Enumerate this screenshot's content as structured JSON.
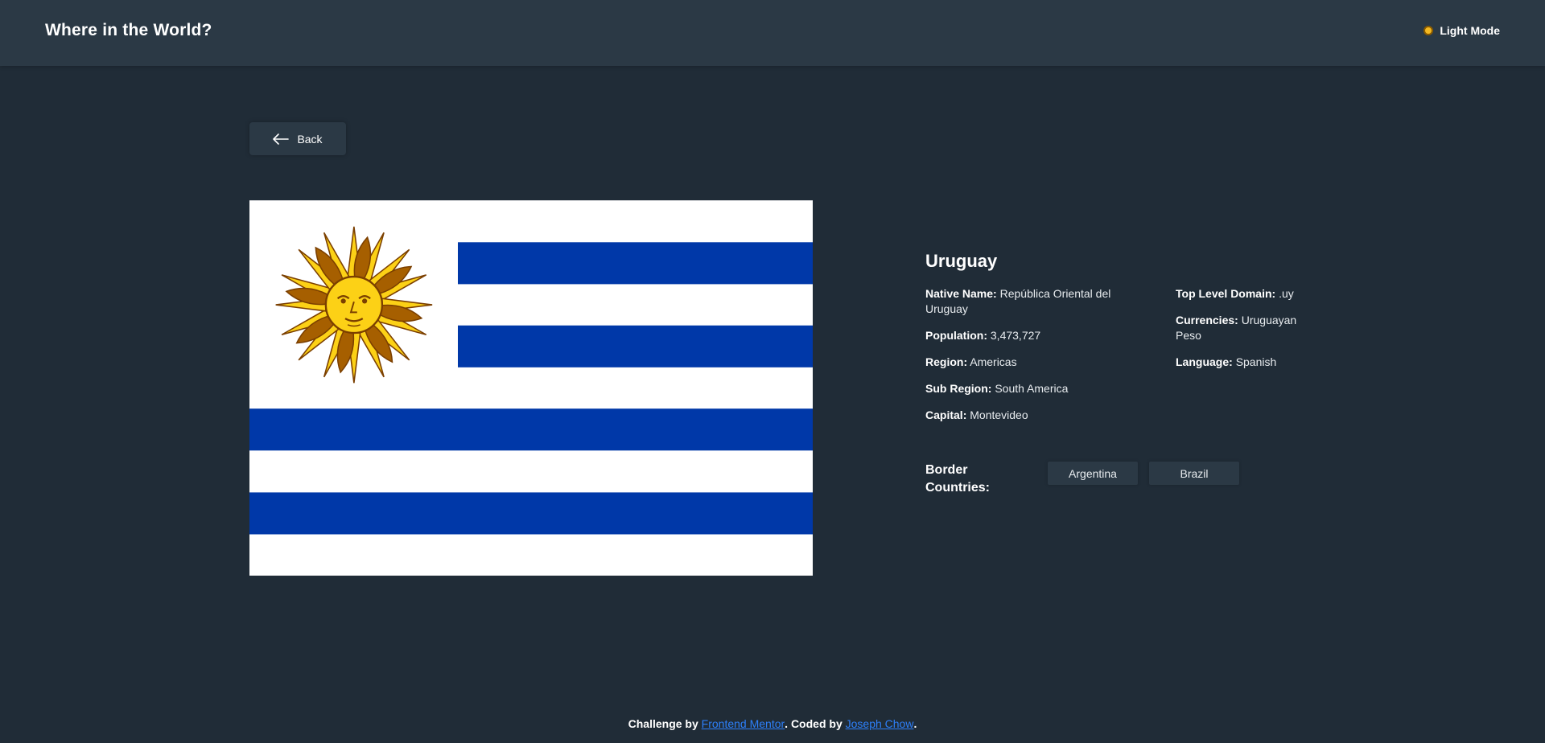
{
  "header": {
    "title": "Where in the World?",
    "theme_toggle_label": "Light Mode",
    "theme_icon": "sun-icon"
  },
  "back_button": {
    "label": "Back",
    "icon": "arrow-left-icon"
  },
  "flag": {
    "alt": "Flag of Uruguay",
    "colors": {
      "blue": "#0038a8",
      "white": "#ffffff",
      "sun": "#fcd116",
      "sun_outline": "#7b3f00"
    }
  },
  "country": {
    "name": "Uruguay",
    "native_name_label": "Native Name",
    "native_name": "República Oriental del Uruguay",
    "population_label": "Population",
    "population": "3,473,727",
    "region_label": "Region",
    "region": "Americas",
    "sub_region_label": "Sub Region",
    "sub_region": "South America",
    "capital_label": "Capital",
    "capital": "Montevideo",
    "tld_label": "Top Level Domain",
    "tld": ".uy",
    "currencies_label": "Currencies",
    "currencies": "Uruguayan Peso",
    "language_label": "Language",
    "language": "Spanish",
    "borders_label": "Border Countries:",
    "borders": [
      "Argentina",
      "Brazil"
    ]
  },
  "footer": {
    "prefix": "Challenge by ",
    "link1": "Frontend Mentor",
    "middle": ". Coded by ",
    "link2": "Joseph Chow",
    "suffix": "."
  },
  "colors": {
    "background": "#202c37",
    "elements": "#2b3945",
    "text": "#ffffff",
    "link": "#2d7ff9"
  }
}
